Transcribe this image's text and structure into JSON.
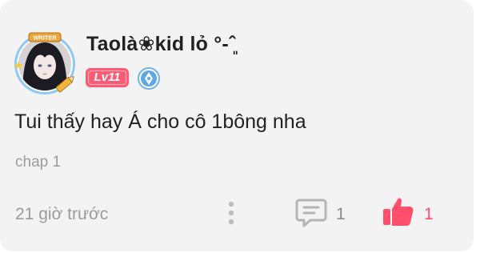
{
  "comment_card": {
    "avatar_frame_label": "WRITER",
    "username": "Taolà❀kid lỏ °-ˆ͈ ",
    "level_badge": "Lv11",
    "comment_text": "Tui thấy hay Á cho cô 1bông nha",
    "chapter": "chap 1",
    "timestamp": "21 giờ trước",
    "reply_count": "1",
    "like_count": "1"
  },
  "icons": {
    "more": "more-vertical-icon",
    "reply": "comment-icon",
    "like": "thumbs-up-icon",
    "role": "writer-pen-badge-icon"
  },
  "colors": {
    "level_badge": "#ff5a73",
    "like": "#ff4f6c",
    "muted_text": "#9b9b9b",
    "card_background": "#f3f3f3"
  }
}
